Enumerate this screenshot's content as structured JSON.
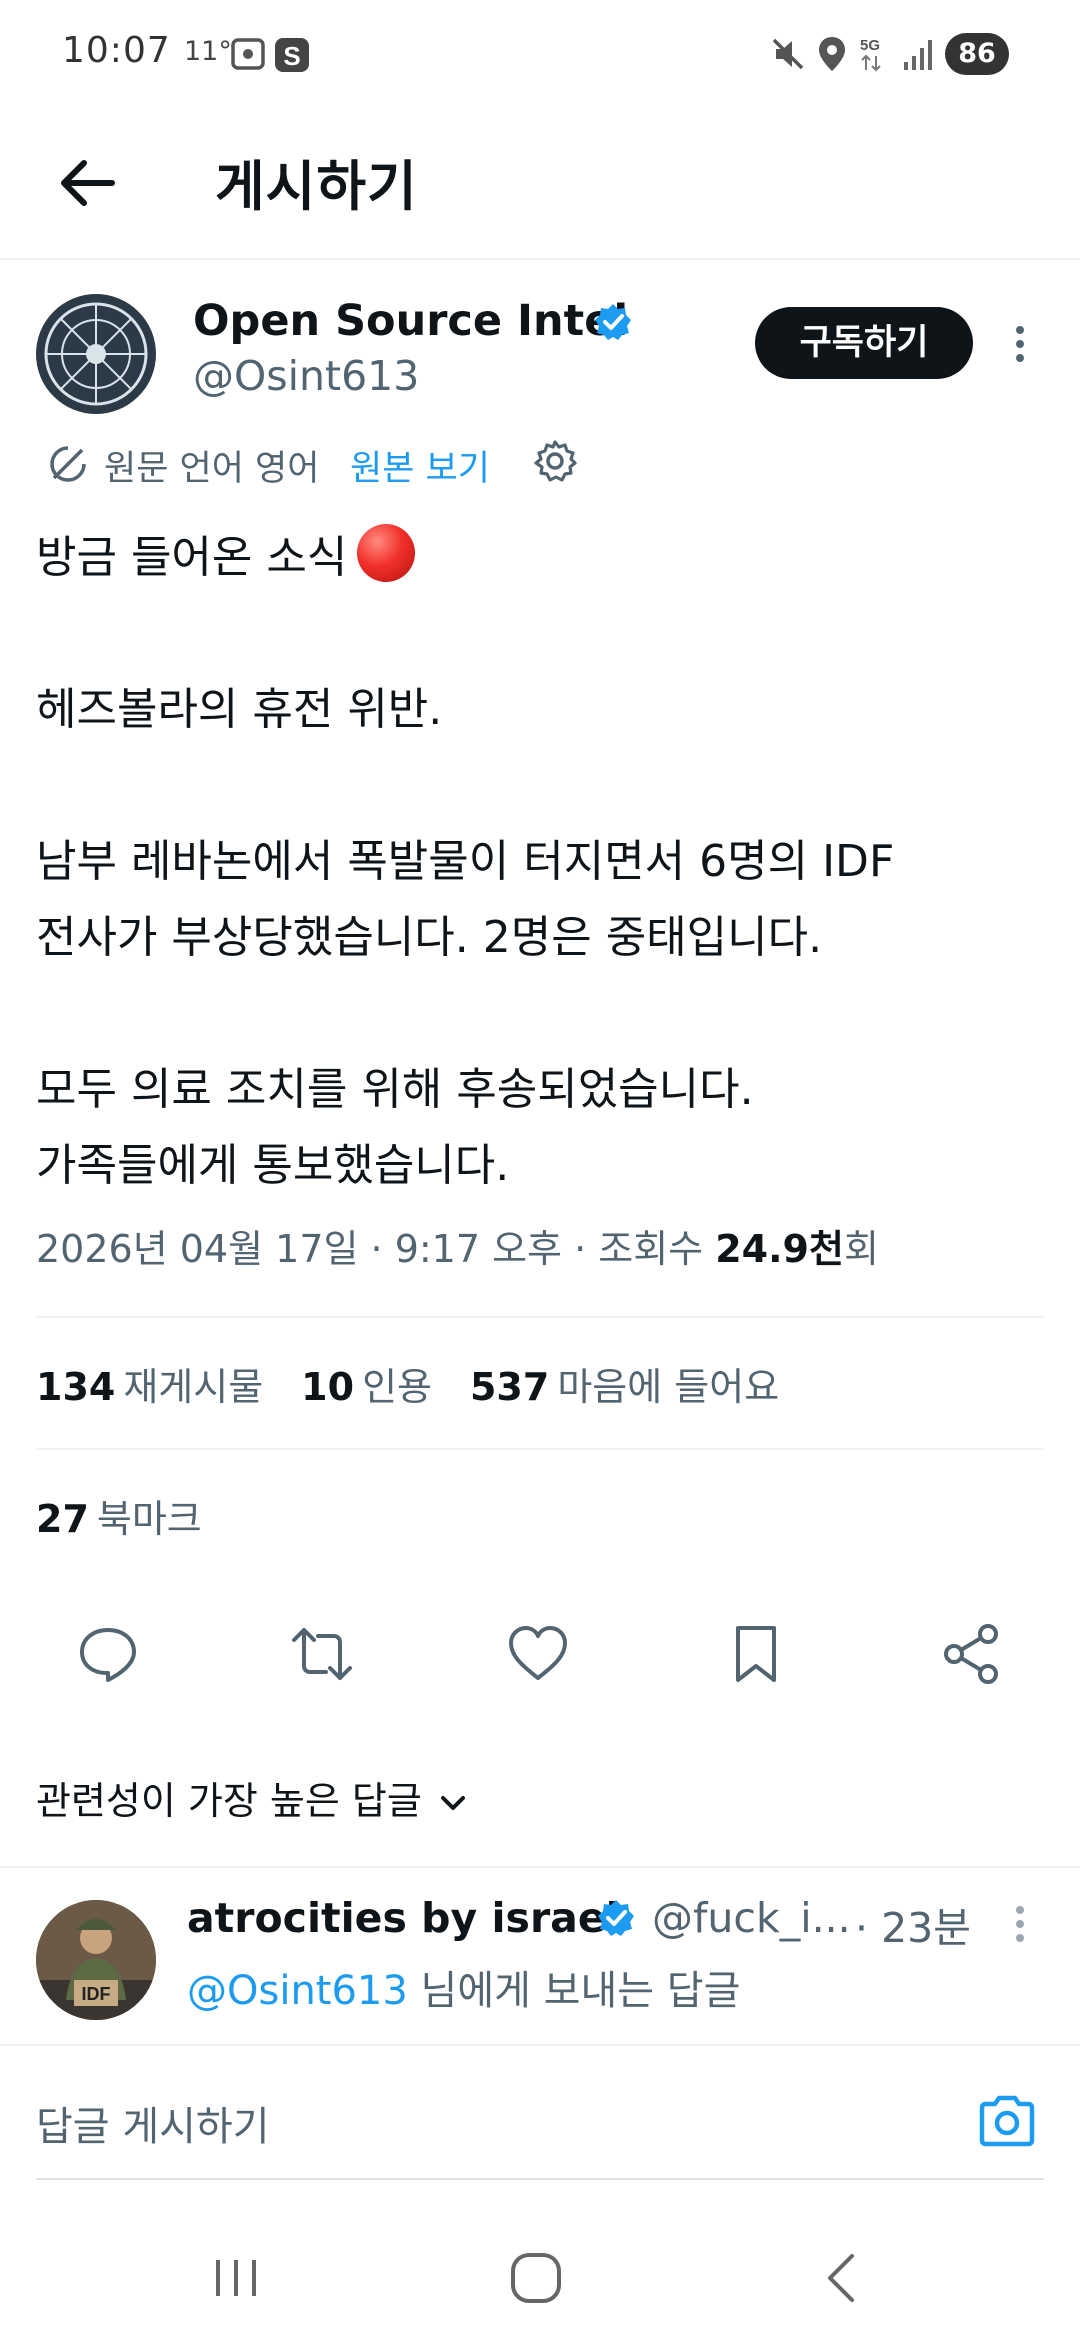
{
  "status_bar": {
    "time": "10:07",
    "temp": "11°",
    "battery": "86"
  },
  "header": {
    "title": "게시하기"
  },
  "post": {
    "author_name": "Open Source Intel",
    "author_handle": "@Osint613",
    "subscribe_label": "구독하기",
    "translate_lang": "원문 언어 영어",
    "translate_link": "원본 보기",
    "body": {
      "line1": "방금 들어온 소식",
      "para2": "헤즈볼라의 휴전 위반.",
      "para3": "남부 레바논에서 폭발물이 터지면서 6명의 IDF\n전사가 부상당했습니다. 2명은 중태입니다.",
      "para4": "모두 의료 조치를 위해 후송되었습니다.\n가족들에게 통보했습니다."
    },
    "meta": {
      "datetime": "2026년 04월 17일 · 9:17 오후 · 조회수 ",
      "views": "24.9천",
      "views_suffix": "회"
    },
    "stats": {
      "reposts": "134",
      "reposts_label": "재게시물",
      "quotes": "10",
      "quotes_label": "인용",
      "likes": "537",
      "likes_label": "마음에 들어요",
      "bookmarks": "27",
      "bookmarks_label": "북마크"
    }
  },
  "actions": [
    "reply-icon",
    "repost-icon",
    "like-icon",
    "bookmark-icon",
    "share-icon"
  ],
  "replies": {
    "sort_label": "관련성이 가장 높은 답글",
    "items": [
      {
        "name": "atrocities by israel",
        "handle": "@fuck_i...",
        "time": "· 23분",
        "reply_to_mention": "@Osint613",
        "reply_to_suffix": " 님에게 보내는 답글"
      }
    ]
  },
  "compose": {
    "placeholder": "답글 게시하기"
  },
  "colors": {
    "accent": "#1d9bf0",
    "text": "#0f1419",
    "secondary": "#536471",
    "subscribe_bg": "#0f1419"
  }
}
